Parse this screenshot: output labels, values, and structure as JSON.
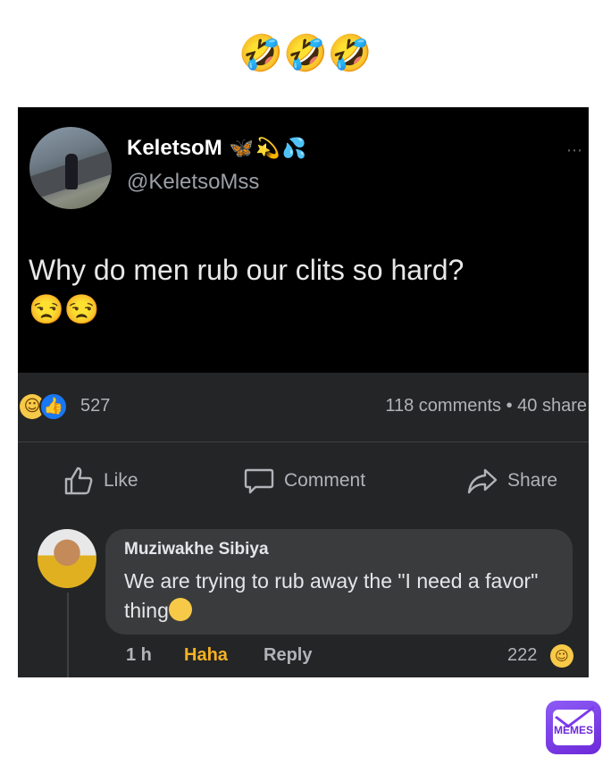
{
  "caption": {
    "emojis": "🤣🤣🤣"
  },
  "post": {
    "author_name": "KeletsoM",
    "author_emojis": "🦋💫💦",
    "handle": "@KeletsoMss",
    "more_icon": "⋯",
    "text": "Why do men rub our clits so hard?",
    "text_emojis": "😒😒"
  },
  "engagement": {
    "reaction_count": "527",
    "stats": "118 comments • 40 share"
  },
  "actions": {
    "like": "Like",
    "comment": "Comment",
    "share": "Share"
  },
  "comment": {
    "name": "Muziwakhe Sibiya",
    "text": "We are trying to rub away the \"I need a favor\" thing",
    "time": "1 h",
    "haha_label": "Haha",
    "reply_label": "Reply",
    "reaction_count": "222"
  },
  "watermark": {
    "label": "MEMES"
  },
  "colors": {
    "post_bg": "#000000",
    "panel_bg": "#242526",
    "bubble_bg": "#3a3b3c",
    "haha_accent": "#f7b125",
    "like_blue": "#1877f2",
    "memes_purple": "#7c3aed"
  }
}
